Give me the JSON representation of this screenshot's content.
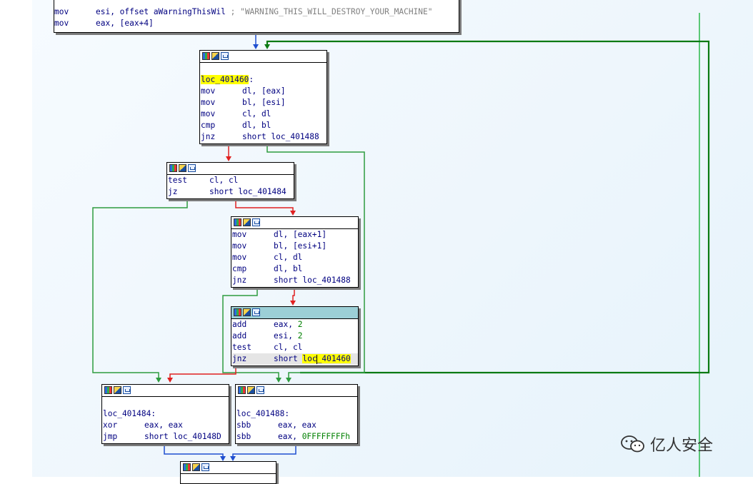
{
  "top_block": {
    "lines": [
      {
        "mn": "mov",
        "op": "esi, offset aWarningThisWil",
        "comment": "; \"WARNING_THIS_WILL_DESTROY_YOUR_MACHINE\""
      },
      {
        "mn": "mov",
        "op": "eax, [eax+4]"
      }
    ]
  },
  "block1": {
    "label": "loc_401460",
    "label_suffix": ":",
    "lines": [
      {
        "mn": "mov",
        "op": "dl, [eax]"
      },
      {
        "mn": "mov",
        "op": "bl, [esi]"
      },
      {
        "mn": "mov",
        "op": "cl, dl"
      },
      {
        "mn": "cmp",
        "op": "dl, bl"
      },
      {
        "mn": "jnz",
        "op": "short loc_401488"
      }
    ]
  },
  "block2": {
    "lines": [
      {
        "mn": "test",
        "op": "cl, cl"
      },
      {
        "mn": "jz",
        "op": "short loc_401484"
      }
    ]
  },
  "block3": {
    "lines": [
      {
        "mn": "mov",
        "op": "dl, [eax+1]"
      },
      {
        "mn": "mov",
        "op": "bl, [esi+1]"
      },
      {
        "mn": "mov",
        "op": "cl, dl"
      },
      {
        "mn": "cmp",
        "op": "dl, bl"
      },
      {
        "mn": "jnz",
        "op": "short loc_401488"
      }
    ]
  },
  "block4": {
    "lines": [
      {
        "mn": "add",
        "op": "eax, ",
        "num": "2"
      },
      {
        "mn": "add",
        "op": "esi, ",
        "num": "2"
      },
      {
        "mn": "test",
        "op": "cl, cl"
      }
    ],
    "jump": {
      "mn": "jnz",
      "op_prefix": "short ",
      "target_a": "loc",
      "target_b": "_401460"
    }
  },
  "block5": {
    "label": "loc_401484:",
    "lines": [
      {
        "mn": "xor",
        "op": "eax, eax"
      },
      {
        "mn": "jmp",
        "op": "short loc_40148D"
      }
    ]
  },
  "block6": {
    "label": "loc_401488:",
    "lines": [
      {
        "mn": "sbb",
        "op": "eax, eax"
      },
      {
        "mn": "sbb",
        "op": "eax, ",
        "num": "0FFFFFFFFh"
      }
    ]
  },
  "watermark": {
    "text": "亿人安全"
  },
  "colors": {
    "edge_true": "#2e9c3f",
    "edge_false": "#e02020",
    "edge_uncond": "#1f4fd0",
    "loop_edge": "#0a7a12",
    "selected_header": "#9ccfd6",
    "label_highlight": "#ffff00"
  }
}
